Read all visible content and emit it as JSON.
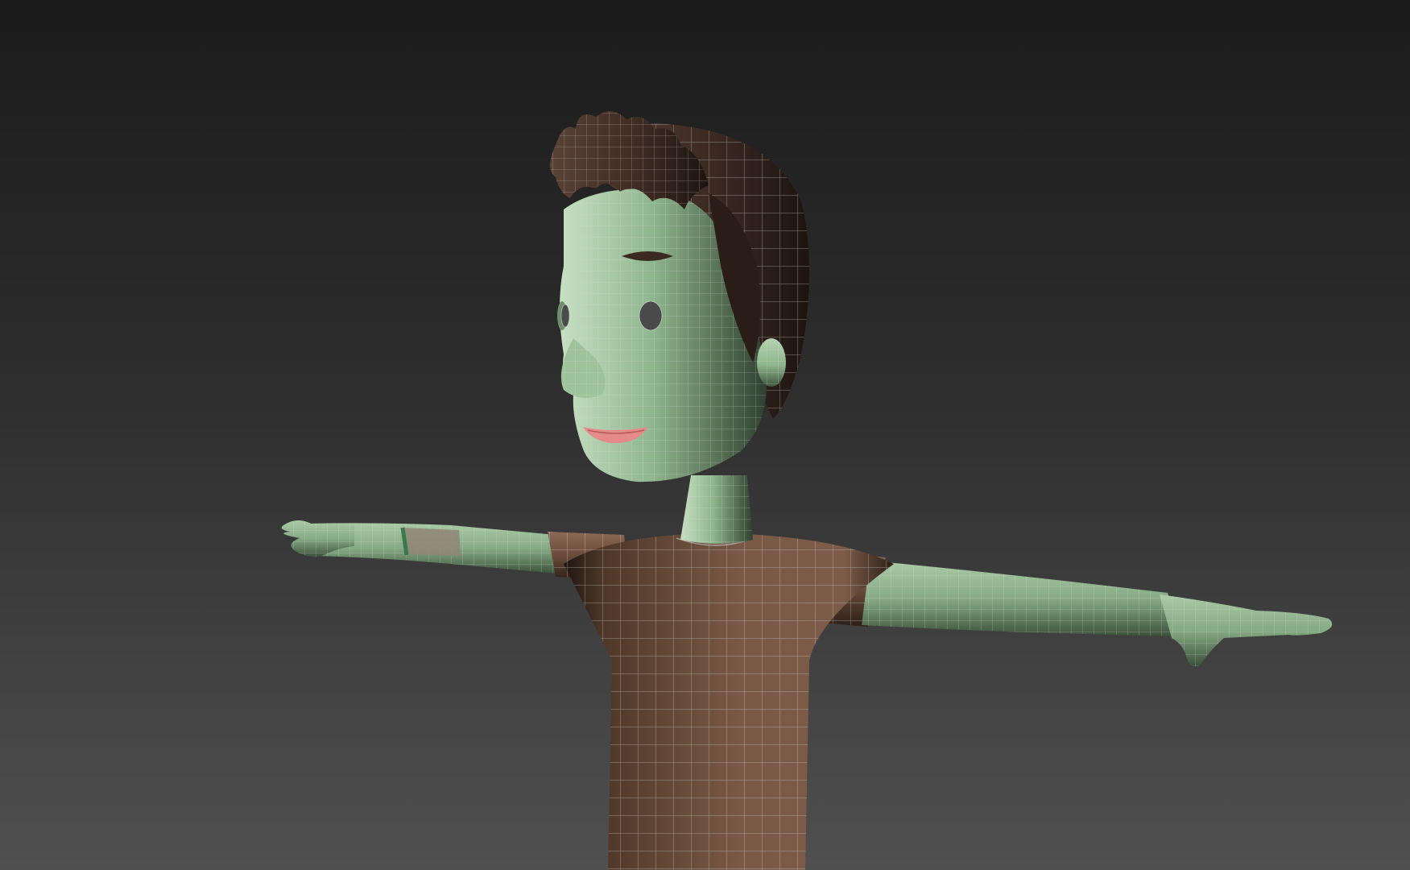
{
  "viewport": {
    "background_top": "#1b1b1b",
    "background_bottom": "#505050",
    "display_mode": "shaded-wireframe"
  },
  "model": {
    "skin_color": "#8fb68d",
    "skin_shadow": "#2f3f2f",
    "shirt_color": "#6b4c3a",
    "shirt_shadow": "#2c1f18",
    "hair_color": "#3c2a22",
    "hair_shadow": "#1d1410",
    "lip_color": "#e58a8a",
    "wire_color": "#d8d8d8",
    "pose": "T-pose"
  }
}
